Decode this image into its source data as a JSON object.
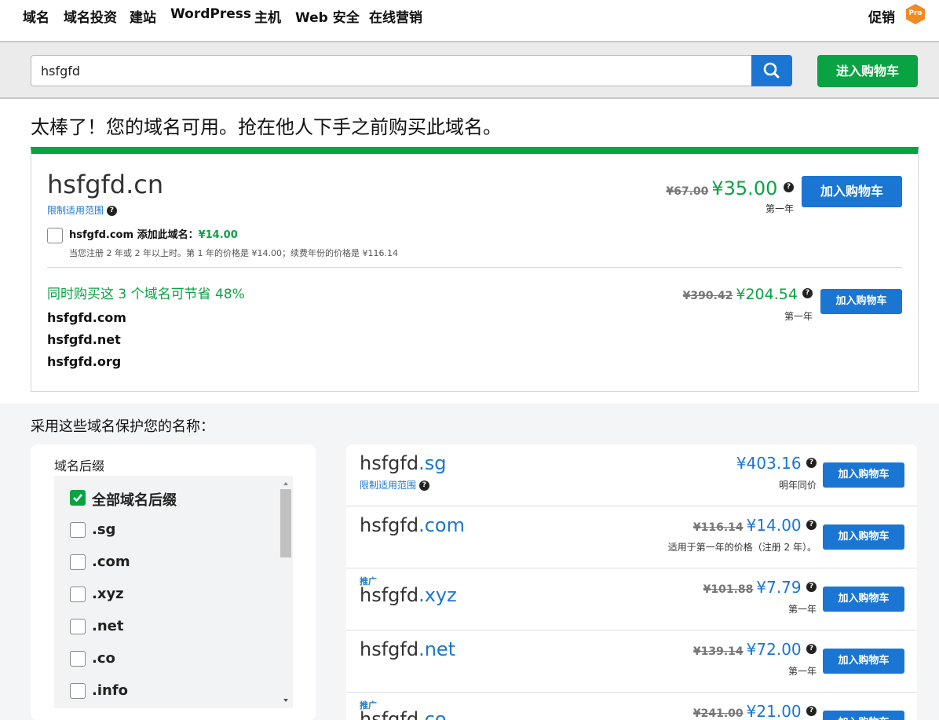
{
  "nav": {
    "items": [
      "域名",
      "域名投资",
      "建站",
      "WordPress",
      "主机",
      "Web 安全",
      "在线营销"
    ],
    "promo": "促销",
    "badge": "Pro"
  },
  "search": {
    "value": "hsfgfd",
    "cart_button": "进入购物车"
  },
  "headline": "太棒了！您的域名可用。抢在他人下手之前购买此域名。",
  "featured": {
    "domain": "hsfgfd.cn",
    "restriction": "限制适用范围",
    "old_price": "¥67.00",
    "price": "¥35.00",
    "period": "第一年",
    "button": "加入购物车",
    "addon": {
      "domain": "hsfgfd.com",
      "label": "添加此域名：",
      "price": "¥14.00",
      "note": "当您注册 2 年或 2 年以上时。第 1 年的价格是 ¥14.00；续费年份的价格是 ¥116.14",
      "checked": false
    },
    "bundle": {
      "title": "同时购买这 3 个域名可节省 48%",
      "domains": [
        "hsfgfd.com",
        "hsfgfd.net",
        "hsfgfd.org"
      ],
      "old_price": "¥390.42",
      "price": "¥204.54",
      "period": "第一年",
      "button": "加入购物车"
    }
  },
  "protect_title": "采用这些域名保护您的名称：",
  "filter": {
    "title": "域名后缀",
    "items": [
      {
        "label": "全部域名后缀",
        "checked": true
      },
      {
        "label": ".sg",
        "checked": false
      },
      {
        "label": ".com",
        "checked": false
      },
      {
        "label": ".xyz",
        "checked": false
      },
      {
        "label": ".net",
        "checked": false
      },
      {
        "label": ".co",
        "checked": false
      },
      {
        "label": ".info",
        "checked": false
      }
    ]
  },
  "results": [
    {
      "name": "hsfgfd",
      "tld": ".sg",
      "tag": "",
      "sub": "限制适用范围",
      "old_price": "",
      "price": "¥403.16",
      "note": "明年同价",
      "button": "加入购物车"
    },
    {
      "name": "hsfgfd",
      "tld": ".com",
      "tag": "",
      "sub": "",
      "old_price": "¥116.14",
      "price": "¥14.00",
      "note": "适用于第一年的价格（注册 2 年）。",
      "button": "加入购物车"
    },
    {
      "name": "hsfgfd",
      "tld": ".xyz",
      "tag": "推广",
      "sub": "",
      "old_price": "¥101.88",
      "price": "¥7.79",
      "note": "第一年",
      "button": "加入购物车"
    },
    {
      "name": "hsfgfd",
      "tld": ".net",
      "tag": "",
      "sub": "",
      "old_price": "¥139.14",
      "price": "¥72.00",
      "note": "第一年",
      "button": "加入购物车"
    },
    {
      "name": "hsfgfd",
      "tld": ".co",
      "tag": "推广",
      "sub": "",
      "old_price": "¥241.00",
      "price": "¥21.00",
      "note": "",
      "button": "加入购物车"
    }
  ],
  "colors": {
    "accent_green": "#0aa344",
    "accent_blue": "#1a76d2",
    "badge_orange": "#f08a24"
  }
}
